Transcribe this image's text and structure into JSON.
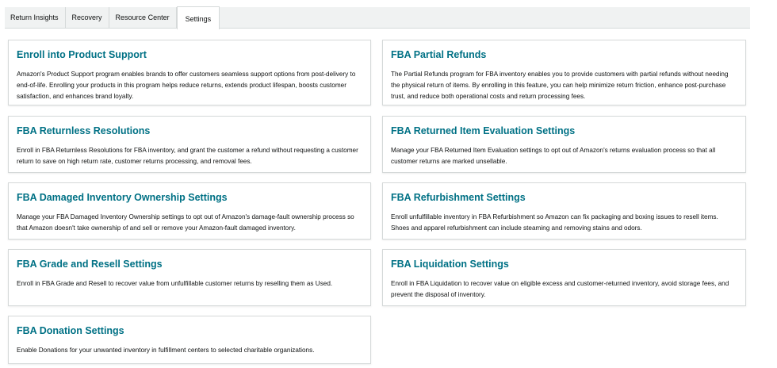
{
  "tabs": [
    {
      "label": "Return Insights"
    },
    {
      "label": "Recovery"
    },
    {
      "label": "Resource Center"
    },
    {
      "label": "Settings",
      "active": true
    }
  ],
  "cards": [
    {
      "title": "Enroll into Product Support",
      "description": "Amazon's Product Support program enables brands to offer customers seamless support options from post-delivery to end-of-life. Enrolling your products in this program helps reduce returns, extends product lifespan, boosts customer satisfaction, and enhances brand loyalty."
    },
    {
      "title": "FBA Partial Refunds",
      "description": "The Partial Refunds program for FBA inventory enables you to provide customers with partial refunds without needing the physical return of items. By enrolling in this feature, you can help minimize return friction, enhance post-purchase trust, and reduce both operational costs and return processing fees."
    },
    {
      "title": "FBA Returnless Resolutions",
      "description": "Enroll in FBA Returnless Resolutions for FBA inventory, and grant the customer a refund without requesting a customer return to save on high return rate, customer returns processing, and removal fees."
    },
    {
      "title": "FBA Returned Item Evaluation Settings",
      "description": "Manage your FBA Returned Item Evaluation settings to opt out of Amazon's returns evaluation process so that all customer returns are marked unsellable."
    },
    {
      "title": "FBA Damaged Inventory Ownership Settings",
      "description": "Manage your FBA Damaged Inventory Ownership settings to opt out of Amazon's damage-fault ownership process so that Amazon doesn't take ownership of and sell or remove your Amazon-fault damaged inventory."
    },
    {
      "title": "FBA Refurbishment Settings",
      "description": "Enroll unfulfillable inventory in FBA Refurbishment so Amazon can fix packaging and boxing issues to resell items. Shoes and apparel refurbishment can include steaming and removing stains and odors."
    },
    {
      "title": "FBA Grade and Resell Settings",
      "description": "Enroll in FBA Grade and Resell to recover value from unfulfillable customer returns by reselling them as Used."
    },
    {
      "title": "FBA Liquidation Settings",
      "description": "Enroll in FBA Liquidation to recover value on eligible excess and customer-returned inventory, avoid storage fees, and prevent the disposal of inventory."
    },
    {
      "title": "FBA Donation Settings",
      "description": "Enable Donations for your unwanted inventory in fulfillment centers to selected charitable organizations."
    }
  ],
  "colors": {
    "link_title": "#007185",
    "border": "#d5d9d9",
    "tab_bar_bg": "#f0f2f2"
  }
}
